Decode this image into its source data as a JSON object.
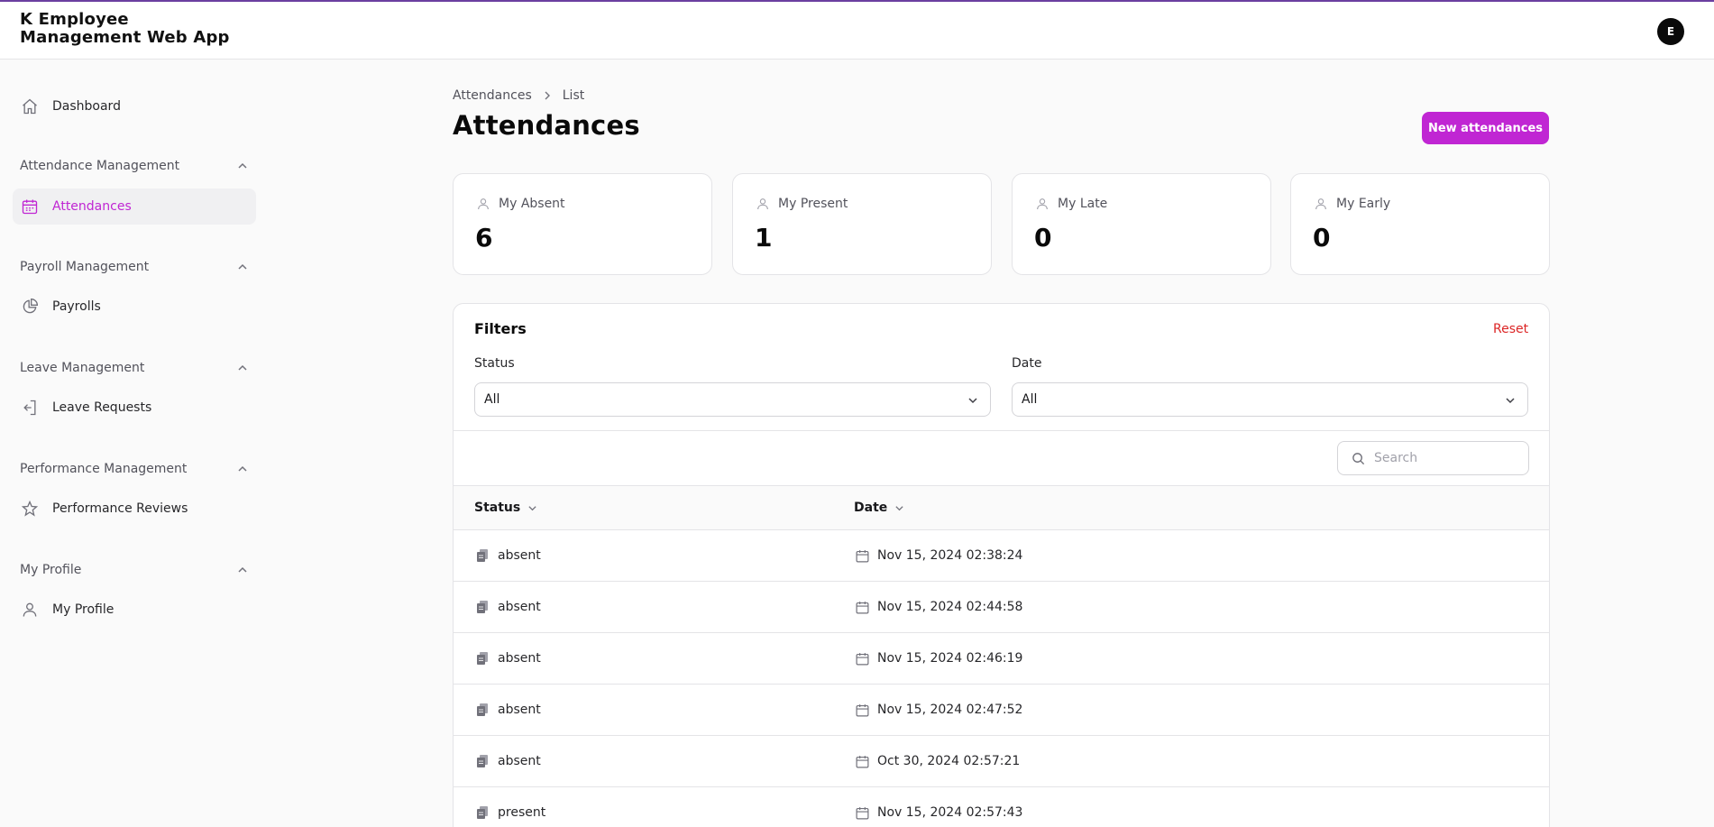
{
  "app": {
    "title": "K Employee Management Web App",
    "avatar_initial": "E"
  },
  "sidebar": {
    "dashboard": {
      "label": "Dashboard",
      "icon": "home-icon"
    },
    "groups": [
      {
        "label": "Attendance Management",
        "items": [
          {
            "label": "Attendances",
            "icon": "calendar-icon",
            "active": true
          }
        ]
      },
      {
        "label": "Payroll Management",
        "items": [
          {
            "label": "Payrolls",
            "icon": "pie-chart-icon"
          }
        ]
      },
      {
        "label": "Leave Management",
        "items": [
          {
            "label": "Leave Requests",
            "icon": "exit-door-icon"
          }
        ]
      },
      {
        "label": "Performance Management",
        "items": [
          {
            "label": "Performance Reviews",
            "icon": "star-icon"
          }
        ]
      },
      {
        "label": "My Profile",
        "items": [
          {
            "label": "My Profile",
            "icon": "user-icon"
          }
        ]
      }
    ]
  },
  "breadcrumb": {
    "items": [
      "Attendances",
      "List"
    ]
  },
  "page": {
    "title": "Attendances",
    "new_button": "New attendances"
  },
  "stats": [
    {
      "label": "My Absent",
      "value": "6"
    },
    {
      "label": "My Present",
      "value": "1"
    },
    {
      "label": "My Late",
      "value": "0"
    },
    {
      "label": "My Early",
      "value": "0"
    }
  ],
  "filters": {
    "title": "Filters",
    "reset": "Reset",
    "status": {
      "label": "Status",
      "value": "All"
    },
    "date": {
      "label": "Date",
      "value": "All"
    }
  },
  "search": {
    "placeholder": "Search"
  },
  "table": {
    "columns": [
      "Status",
      "Date"
    ],
    "rows": [
      {
        "status": "absent",
        "date": "Nov 15, 2024 02:38:24"
      },
      {
        "status": "absent",
        "date": "Nov 15, 2024 02:44:58"
      },
      {
        "status": "absent",
        "date": "Nov 15, 2024 02:46:19"
      },
      {
        "status": "absent",
        "date": "Nov 15, 2024 02:47:52"
      },
      {
        "status": "absent",
        "date": "Oct 30, 2024 02:57:21"
      },
      {
        "status": "present",
        "date": "Nov 15, 2024 02:57:43"
      }
    ]
  },
  "colors": {
    "accent": "#c026d3",
    "danger": "#dc2626",
    "topbar_border": "#6b3fa0"
  }
}
